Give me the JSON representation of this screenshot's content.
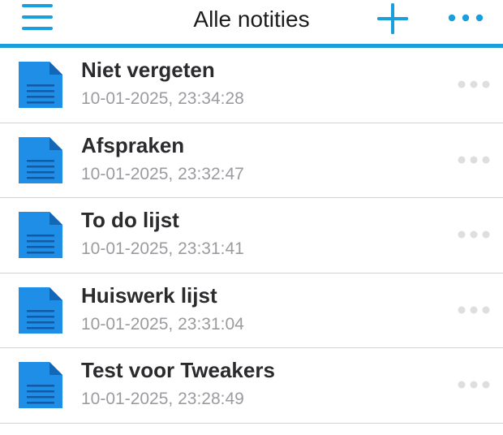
{
  "header": {
    "title": "Alle notities",
    "accent_color": "#1a9fdc",
    "menu_icon": "hamburger-menu-icon",
    "add_icon": "plus-icon",
    "more_icon": "more-horizontal-icon"
  },
  "notes": [
    {
      "title": "Niet vergeten",
      "date": "10-01-2025, 23:34:28",
      "icon": "document-icon"
    },
    {
      "title": "Afspraken",
      "date": "10-01-2025, 23:32:47",
      "icon": "document-icon"
    },
    {
      "title": "To do lijst",
      "date": "10-01-2025, 23:31:41",
      "icon": "document-icon"
    },
    {
      "title": "Huiswerk lijst",
      "date": "10-01-2025, 23:31:04",
      "icon": "document-icon"
    },
    {
      "title": "Test voor Tweakers",
      "date": "10-01-2025, 23:28:49",
      "icon": "document-icon"
    }
  ]
}
